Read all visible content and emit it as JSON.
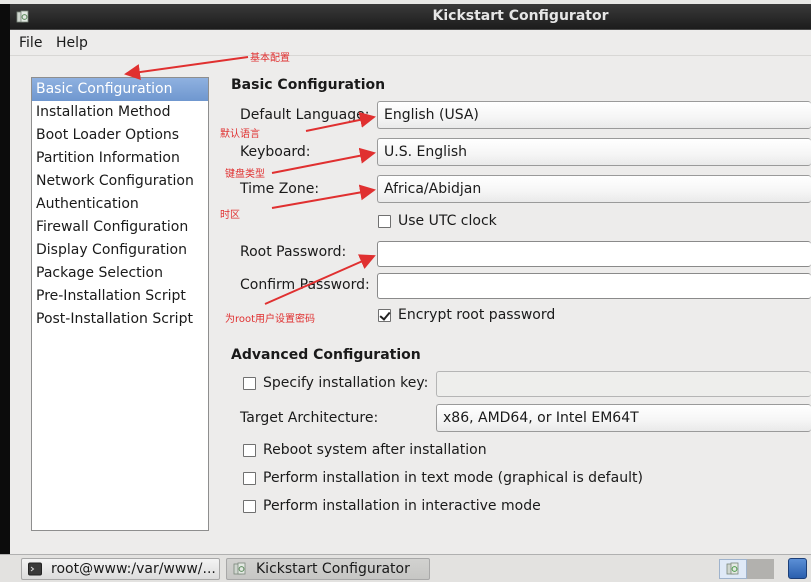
{
  "window": {
    "title": "Kickstart Configurator"
  },
  "menu": {
    "items": [
      "File",
      "Help"
    ]
  },
  "sidebar": {
    "selected_index": 0,
    "items": [
      "Basic Configuration",
      "Installation Method",
      "Boot Loader Options",
      "Partition Information",
      "Network Configuration",
      "Authentication",
      "Firewall Configuration",
      "Display Configuration",
      "Package Selection",
      "Pre-Installation Script",
      "Post-Installation Script"
    ]
  },
  "basic": {
    "title": "Basic Configuration",
    "default_language_label": "Default Language:",
    "default_language_value": "English (USA)",
    "keyboard_label": "Keyboard:",
    "keyboard_value": "U.S. English",
    "timezone_label": "Time Zone:",
    "timezone_value": "Africa/Abidjan",
    "utc_clock_label": "Use UTC clock",
    "utc_clock_checked": false,
    "root_password_label": "Root Password:",
    "root_password_value": "",
    "confirm_password_label": "Confirm Password:",
    "confirm_password_value": "",
    "encrypt_label": "Encrypt root password",
    "encrypt_checked": true
  },
  "advanced": {
    "title": "Advanced Configuration",
    "install_key_label": "Specify installation key:",
    "install_key_checked": false,
    "install_key_value": "",
    "target_arch_label": "Target Architecture:",
    "target_arch_value": "x86, AMD64, or Intel EM64T",
    "reboot_label": "Reboot system after installation",
    "reboot_checked": false,
    "text_mode_label": "Perform installation in text mode (graphical is default)",
    "text_mode_checked": false,
    "interactive_label": "Perform installation in interactive mode",
    "interactive_checked": false
  },
  "annotations": {
    "basic_config": "基本配置",
    "default_language": "默认语言",
    "keyboard": "键盘类型",
    "timezone": "时区",
    "root_password": "为root用户设置密码",
    "color": "#e03030"
  },
  "taskbar": {
    "terminal_label": "root@www:/var/www/...",
    "kickstart_label": "Kickstart Configurator",
    "terminal_icon": "terminal-icon",
    "kickstart_icon": "kickstart-icon"
  }
}
